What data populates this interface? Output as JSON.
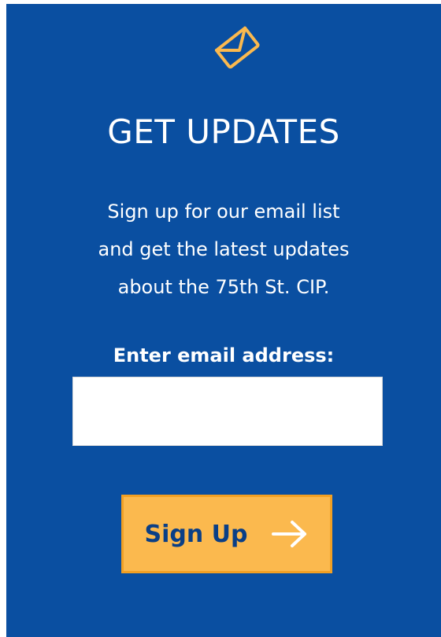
{
  "signup": {
    "title": "GET UPDATES",
    "description_lines": [
      "Sign up for our email list",
      "and get the latest updates",
      "about the 75th St. CIP."
    ],
    "email_label": "Enter email address:",
    "email_value": "",
    "email_placeholder": "",
    "button_label": "Sign Up"
  },
  "icons": {
    "top": "envelope-icon",
    "button": "arrow-right-icon"
  },
  "colors": {
    "panel_bg": "#0a4fa1",
    "accent": "#fbb94e",
    "accent_border": "#f2a023",
    "button_text": "#0a3f86",
    "text": "#ffffff"
  }
}
